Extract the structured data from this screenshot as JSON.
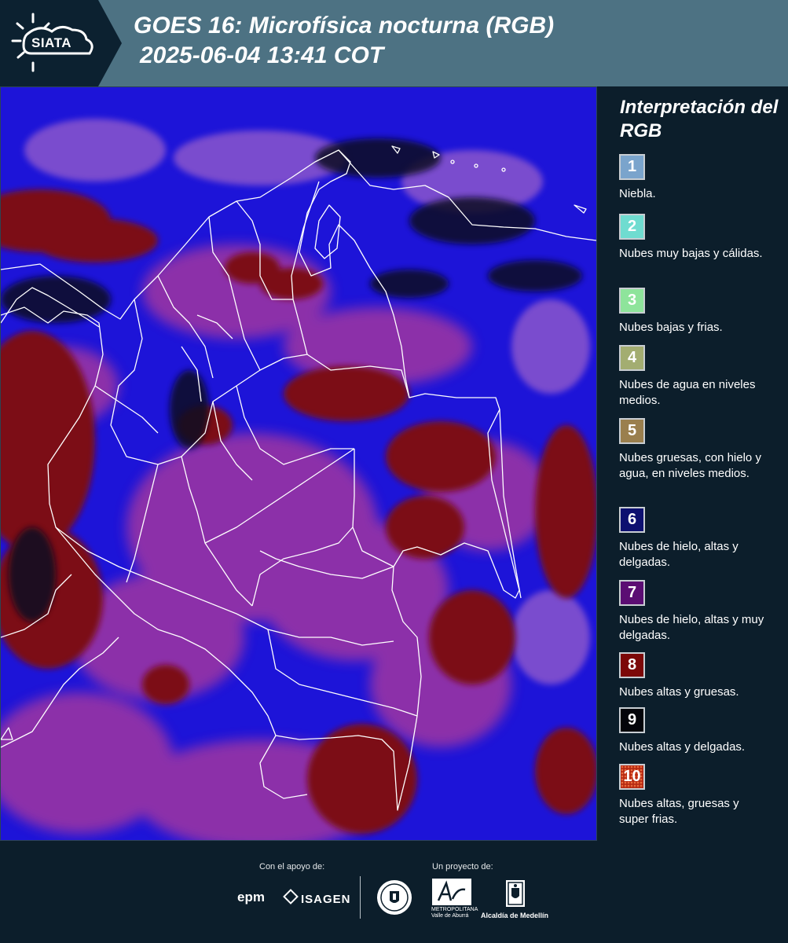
{
  "header": {
    "logo_text": "SIATA",
    "title_line1": "GOES 16: Microfísica nocturna (RGB)",
    "title_line2": "2025-06-04 13:41 COT"
  },
  "map": {
    "colors": {
      "background": "#1d14d8",
      "magenta": "#b03a9e",
      "dark_red": "#7c0a12",
      "dark": "#0a0a24",
      "border": "#ffffff"
    }
  },
  "legend": {
    "title": "Interpretación del RGB",
    "items": [
      {
        "number": "1",
        "label": "Niebla.",
        "color": "#7aa4cc"
      },
      {
        "number": "2",
        "label": "Nubes muy bajas y cálidas.",
        "color": "#6fdcd0"
      },
      {
        "number": "3",
        "label": "Nubes bajas y frias.",
        "color": "#8ee49b"
      },
      {
        "number": "4",
        "label": "Nubes de agua en niveles medios.",
        "color": "#a3ad71"
      },
      {
        "number": "5",
        "label": "Nubes gruesas, con hielo y agua, en niveles medios.",
        "color": "#9a7f4e"
      },
      {
        "number": "6",
        "label": "Nubes de hielo, altas y delgadas.",
        "color": "#0d1070"
      },
      {
        "number": "7",
        "label": "Nubes de hielo, altas y muy delgadas.",
        "color": "#5b0d73"
      },
      {
        "number": "8",
        "label": "Nubes altas y gruesas.",
        "color": "#7c0808"
      },
      {
        "number": "9",
        "label": "Nubes altas y delgadas.",
        "color": "#03040a"
      },
      {
        "number": "10",
        "label": "Nubes altas, gruesas y super frias.",
        "color": "#b62a14"
      }
    ]
  },
  "footer": {
    "support_label": "Con el apoyo de:",
    "project_label": "Un proyecto de:",
    "sponsor_1": "epm",
    "sponsor_2": "ISAGEN",
    "partner_1_sub": "METROPOLITANA Valle de Aburrá",
    "partner_2": "Alcaldía de Medellín"
  }
}
